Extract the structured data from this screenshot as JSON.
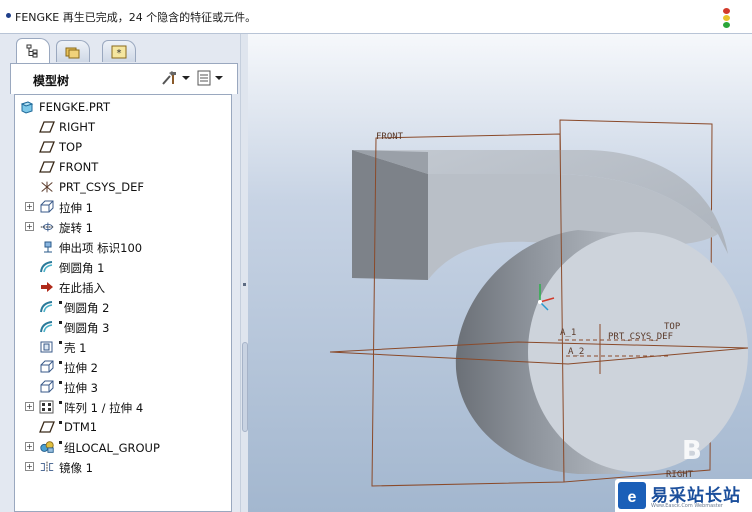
{
  "message_bar": {
    "text": "FENGKE 再生已完成，24 个隐含的特征或元件。",
    "traffic_light_icon": "traffic-light-icon"
  },
  "left_panel": {
    "tabs": [
      {
        "icon": "model-tree-tab-icon",
        "active": true
      },
      {
        "icon": "folder-browser-tab-icon",
        "active": false
      },
      {
        "icon": "favorites-tab-icon",
        "active": false
      }
    ],
    "tree_title": "模型树",
    "tools": [
      {
        "icon": "settings-tools-icon"
      },
      {
        "icon": "show-list-icon"
      }
    ]
  },
  "model_tree": {
    "items": [
      {
        "label": "FENGKE.PRT",
        "icon": "part-icon",
        "expander": false,
        "marked": false,
        "indent": 0
      },
      {
        "label": "RIGHT",
        "icon": "datum-plane-icon",
        "expander": false,
        "marked": false,
        "indent": 1
      },
      {
        "label": "TOP",
        "icon": "datum-plane-icon",
        "expander": false,
        "marked": false,
        "indent": 1
      },
      {
        "label": "FRONT",
        "icon": "datum-plane-icon",
        "expander": false,
        "marked": false,
        "indent": 1
      },
      {
        "label": "PRT_CSYS_DEF",
        "icon": "coordinate-system-icon",
        "expander": false,
        "marked": false,
        "indent": 1
      },
      {
        "label": "拉伸 1",
        "icon": "extrude-icon",
        "expander": true,
        "marked": false,
        "indent": 1
      },
      {
        "label": "旋转 1",
        "icon": "revolve-icon",
        "expander": true,
        "marked": false,
        "indent": 1
      },
      {
        "label": "伸出项 标识100",
        "icon": "protrusion-icon",
        "expander": false,
        "marked": false,
        "indent": 1
      },
      {
        "label": "倒圆角 1",
        "icon": "round-icon",
        "expander": false,
        "marked": false,
        "indent": 1
      },
      {
        "label": "在此插入",
        "icon": "insert-here-arrow-icon",
        "expander": false,
        "marked": false,
        "indent": 1
      },
      {
        "label": "倒圆角 2",
        "icon": "round-icon",
        "expander": false,
        "marked": true,
        "indent": 1
      },
      {
        "label": "倒圆角 3",
        "icon": "round-icon",
        "expander": false,
        "marked": true,
        "indent": 1
      },
      {
        "label": "壳 1",
        "icon": "shell-icon",
        "expander": false,
        "marked": true,
        "indent": 1
      },
      {
        "label": "拉伸 2",
        "icon": "extrude-icon",
        "expander": false,
        "marked": true,
        "indent": 1
      },
      {
        "label": "拉伸 3",
        "icon": "extrude-icon",
        "expander": false,
        "marked": true,
        "indent": 1
      },
      {
        "label": "阵列 1 / 拉伸 4",
        "icon": "pattern-icon",
        "expander": true,
        "marked": true,
        "indent": 1
      },
      {
        "label": "DTM1",
        "icon": "datum-plane-icon",
        "expander": false,
        "marked": true,
        "indent": 1
      },
      {
        "label": "组LOCAL_GROUP",
        "icon": "group-icon",
        "expander": true,
        "marked": true,
        "indent": 1
      },
      {
        "label": "镜像 1",
        "icon": "mirror-icon",
        "expander": true,
        "marked": false,
        "indent": 1
      }
    ]
  },
  "viewport": {
    "datum_labels": {
      "front": "FRONT",
      "top": "TOP",
      "right": "RIGHT",
      "csys": "PRT_CSYS_DEF",
      "a1": "A_1",
      "a2": "A_2"
    },
    "watermark_letter": "B",
    "logo_text": "易采站长站",
    "logo_subtext": "Www.Easck.Com Webmaster"
  },
  "colors": {
    "accent": "#1b5fb8",
    "datum_line": "#8a4a2a",
    "model_face": "#c6ccd4"
  }
}
